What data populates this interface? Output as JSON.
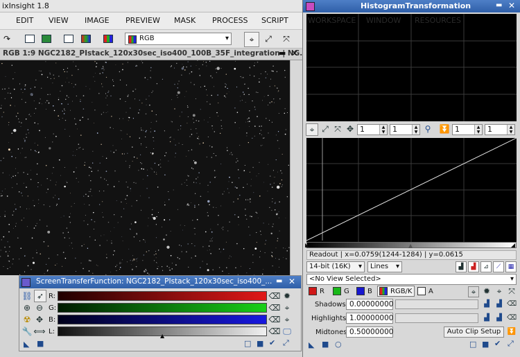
{
  "app": {
    "title": "ixInsight 1.8"
  },
  "menu": [
    "EDIT",
    "VIEW",
    "IMAGE",
    "PREVIEW",
    "MASK",
    "PROCESS",
    "SCRIPT"
  ],
  "toolbar": {
    "channel_select": "RGB"
  },
  "image_window": {
    "title": "RGB 1:9 NGC2182_PIstack_120x30sec_iso400_100B_35F_integration | NG..."
  },
  "stf": {
    "title": "ScreenTransferFunction: NGC2182_PIstack_120x30sec_iso400_...",
    "channels": [
      {
        "label": "R:",
        "color": "#d81818"
      },
      {
        "label": "G:",
        "color": "#18c018"
      },
      {
        "label": "B:",
        "color": "#1818d8"
      },
      {
        "label": "L:",
        "color": "#e8e8e8"
      }
    ]
  },
  "ht": {
    "title": "HistogramTransformation",
    "ghost_tabs": [
      "WORKSPACE",
      "WINDOW",
      "RESOURCES"
    ],
    "zoom": {
      "h_zoom": "1",
      "v_zoom": "1",
      "h_zoom2": "1",
      "v_zoom2": "1"
    },
    "readout": "Readout | x=0.0759(1244-1284) | y=0.0615",
    "resolution": "14-bit (16K)",
    "graph_style": "Lines",
    "view_select": "<No View Selected>",
    "channels": [
      {
        "label": "R",
        "color": "#d01818"
      },
      {
        "label": "G",
        "color": "#18b818"
      },
      {
        "label": "B",
        "color": "#1818d0"
      },
      {
        "label": "RGB/K",
        "color": "#e0e0e0"
      },
      {
        "label": "A",
        "color": "#ffffff"
      }
    ],
    "shadows_label": "Shadows:",
    "shadows_value": "0.00000000",
    "highlights_label": "Highlights:",
    "highlights_value": "1.00000000",
    "midtones_label": "Midtones:",
    "midtones_value": "0.50000000",
    "auto_clip_label": "Auto Clip Setup"
  }
}
